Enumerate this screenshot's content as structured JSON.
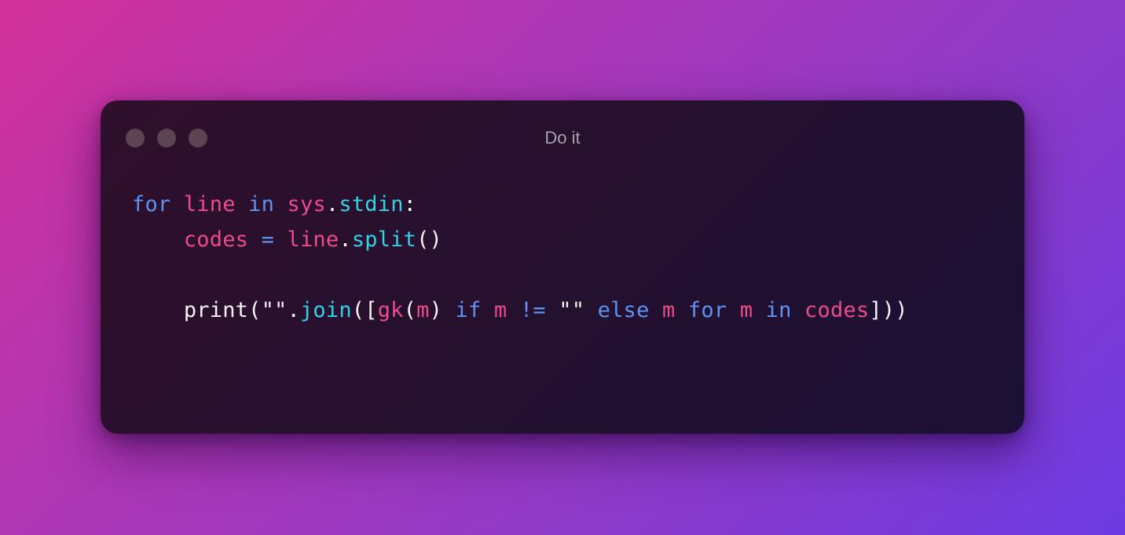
{
  "window": {
    "title": "Do it",
    "colors": {
      "background": "#2a0f2e",
      "keyword": "#5e93f0",
      "variable": "#ec4c8c",
      "function": "#35d2e6",
      "plain": "#f4f4f4"
    }
  },
  "code": {
    "lines": [
      {
        "tokens": [
          {
            "t": "for",
            "k": "kw"
          },
          {
            "t": " ",
            "k": "pl"
          },
          {
            "t": "line",
            "k": "var"
          },
          {
            "t": " ",
            "k": "pl"
          },
          {
            "t": "in",
            "k": "kw"
          },
          {
            "t": " ",
            "k": "pl"
          },
          {
            "t": "sys",
            "k": "var"
          },
          {
            "t": ".",
            "k": "pl"
          },
          {
            "t": "stdin",
            "k": "fn"
          },
          {
            "t": ":",
            "k": "pl"
          }
        ]
      },
      {
        "tokens": [
          {
            "t": "    ",
            "k": "pl"
          },
          {
            "t": "codes",
            "k": "var"
          },
          {
            "t": " ",
            "k": "pl"
          },
          {
            "t": "=",
            "k": "op"
          },
          {
            "t": " ",
            "k": "pl"
          },
          {
            "t": "line",
            "k": "var"
          },
          {
            "t": ".",
            "k": "pl"
          },
          {
            "t": "split",
            "k": "fn"
          },
          {
            "t": "()",
            "k": "pl"
          }
        ]
      },
      {
        "tokens": []
      },
      {
        "tokens": [
          {
            "t": "    ",
            "k": "pl"
          },
          {
            "t": "print",
            "k": "pl"
          },
          {
            "t": "(",
            "k": "pl"
          },
          {
            "t": "\"\"",
            "k": "str"
          },
          {
            "t": ".",
            "k": "pl"
          },
          {
            "t": "join",
            "k": "fn"
          },
          {
            "t": "([",
            "k": "pl"
          },
          {
            "t": "gk",
            "k": "var"
          },
          {
            "t": "(",
            "k": "pl"
          },
          {
            "t": "m",
            "k": "var"
          },
          {
            "t": ")",
            "k": "pl"
          },
          {
            "t": " ",
            "k": "pl"
          },
          {
            "t": "if",
            "k": "kw"
          },
          {
            "t": " ",
            "k": "pl"
          },
          {
            "t": "m",
            "k": "var"
          },
          {
            "t": " ",
            "k": "pl"
          },
          {
            "t": "!=",
            "k": "op"
          },
          {
            "t": " ",
            "k": "pl"
          },
          {
            "t": "\"\"",
            "k": "str"
          },
          {
            "t": " ",
            "k": "pl"
          },
          {
            "t": "else",
            "k": "kw"
          },
          {
            "t": " ",
            "k": "pl"
          },
          {
            "t": "m",
            "k": "var"
          },
          {
            "t": " ",
            "k": "pl"
          },
          {
            "t": "for",
            "k": "kw"
          },
          {
            "t": " ",
            "k": "pl"
          },
          {
            "t": "m",
            "k": "var"
          },
          {
            "t": " ",
            "k": "pl"
          },
          {
            "t": "in",
            "k": "kw"
          },
          {
            "t": " ",
            "k": "pl"
          },
          {
            "t": "codes",
            "k": "var"
          },
          {
            "t": "]))",
            "k": "pl"
          }
        ]
      }
    ]
  }
}
